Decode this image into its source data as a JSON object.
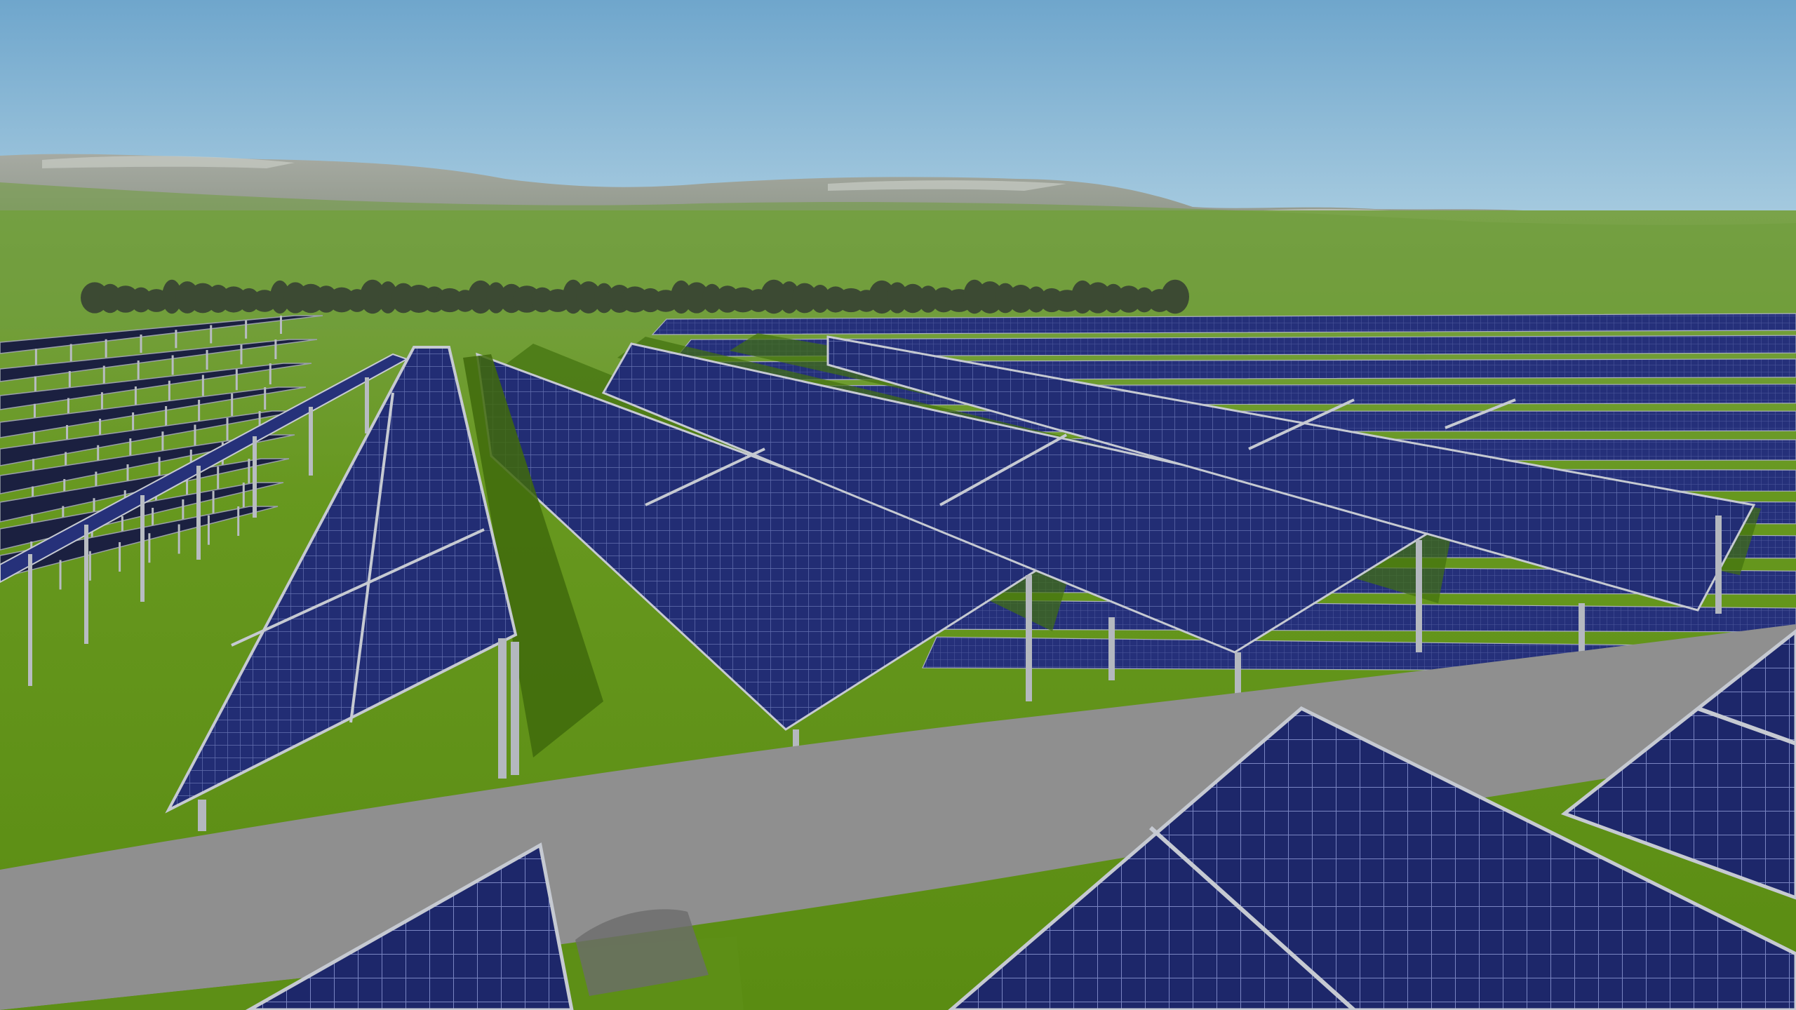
{
  "scene": {
    "colors": {
      "sky_top": "#6fa6cc",
      "sky_bottom": "#b9d7e6",
      "mountain": "#8e948a",
      "mountain_light": "#c2c6bd",
      "grass_far": "#6f9a38",
      "grass_near": "#5d8f16",
      "shadow": "#3f6a0c",
      "road": "#8d8d8d",
      "road_shadow": "#6b6b6b",
      "panel": "#1f2a6e",
      "panel_light": "#2f3d8f",
      "panel_grid": "#6d78b6",
      "frame": "#c6cad2",
      "post": "#b4b8bf",
      "tree": "#34402c"
    }
  }
}
